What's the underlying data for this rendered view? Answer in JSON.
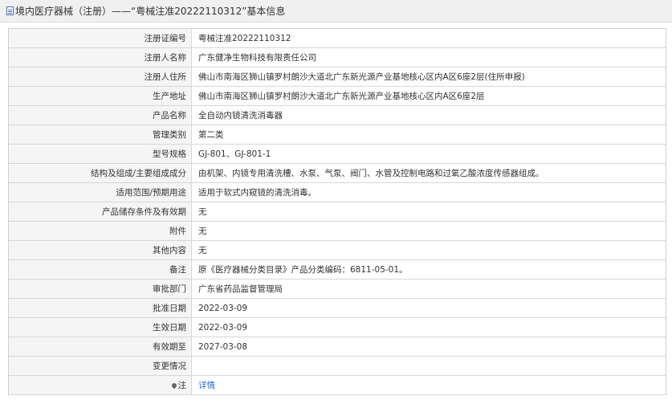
{
  "header": {
    "title": "境内医疗器械（注册）——“粤械注准20222110312”基本信息"
  },
  "rows": [
    {
      "label": "注册证编号",
      "value": "粤械注准20222110312"
    },
    {
      "label": "注册人名称",
      "value": "广东健净生物科技有限责任公司"
    },
    {
      "label": "注册人住所",
      "value": "佛山市南海区狮山镇罗村朗沙大道北广东新光源产业基地核心区内A区6座2层(住所申报)"
    },
    {
      "label": "生产地址",
      "value": "佛山市南海区狮山镇罗村朗沙大道北广东新光源产业基地核心区内A区6座2层"
    },
    {
      "label": "产品名称",
      "value": "全自动内镜清洗消毒器"
    },
    {
      "label": "管理类别",
      "value": "第二类"
    },
    {
      "label": "型号规格",
      "value": "GJ-801、GJ-801-1"
    },
    {
      "label": "结构及组成/主要组成成分",
      "value": "由机架、内镜专用清洗槽、水泵、气泵、阀门、水管及控制电路和过氧乙酸浓度传感器组成。"
    },
    {
      "label": "适用范围/预期用途",
      "value": "适用于软式内窥镜的清洗消毒。"
    },
    {
      "label": "产品储存条件及有效期",
      "value": "无"
    },
    {
      "label": "附件",
      "value": "无"
    },
    {
      "label": "其他内容",
      "value": "无"
    },
    {
      "label": "备注",
      "value": "原《医疗器械分类目录》产品分类编码：6811-05-01。"
    },
    {
      "label": "审批部门",
      "value": "广东省药品监督管理局"
    },
    {
      "label": "批准日期",
      "value": "2022-03-09"
    },
    {
      "label": "生效日期",
      "value": "2022-03-09"
    },
    {
      "label": "有效期至",
      "value": "2027-03-08"
    },
    {
      "label": "变更情况",
      "value": ""
    }
  ],
  "note_row": {
    "label": "注",
    "link_text": "详情",
    "icon": "location-pin-icon"
  }
}
